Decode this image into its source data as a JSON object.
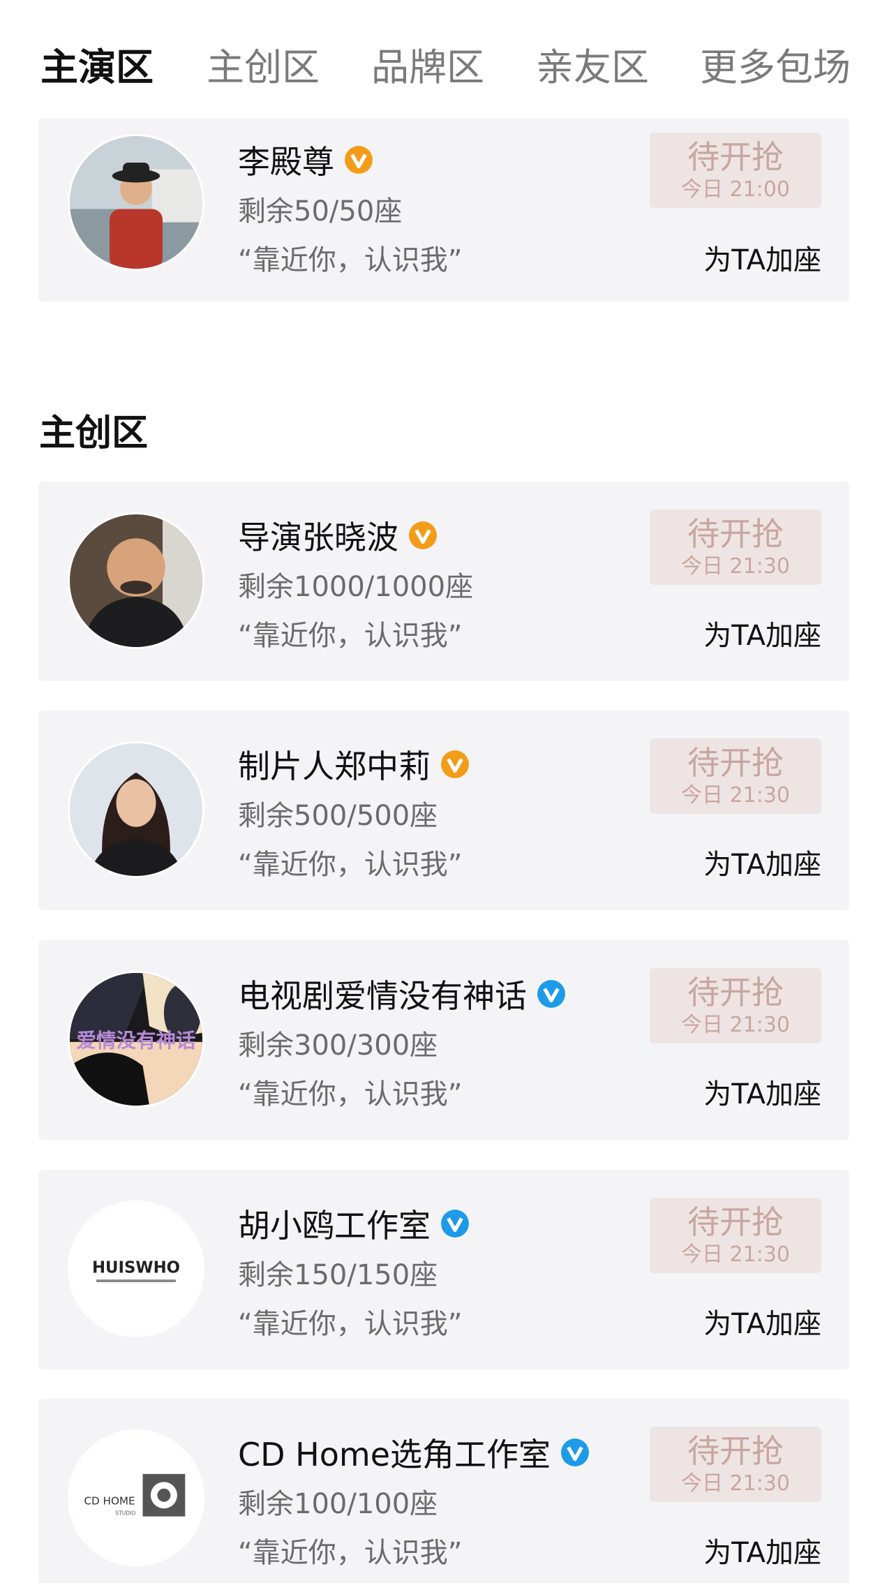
{
  "tabs": [
    "主演区",
    "主创区",
    "品牌区",
    "亲友区",
    "更多包场"
  ],
  "active_tab_index": 0,
  "section_main_creators_title": "主创区",
  "common": {
    "slogan": "“靠近你，认识我”",
    "grab_label": "待开抢",
    "add_seat_label": "为TA加座"
  },
  "colors": {
    "badge_orange": "#f39c1a",
    "badge_blue": "#1e9be8",
    "grab_bg": "#eee4e4",
    "grab_text": "#c8a69f",
    "card_bg": "#f4f4f6"
  },
  "cards": [
    {
      "name": "李殿尊",
      "badge": "orange",
      "seats": "剩余50/50座",
      "time": "今日 21:00",
      "avatar": "person-red-shirt-hat"
    },
    {
      "name": "导演张晓波",
      "badge": "orange",
      "seats": "剩余1000/1000座",
      "time": "今日 21:30",
      "avatar": "bald-man"
    },
    {
      "name": "制片人郑中莉",
      "badge": "orange",
      "seats": "剩余500/500座",
      "time": "今日 21:30",
      "avatar": "woman-dark-hair"
    },
    {
      "name": "电视剧爱情没有神话",
      "badge": "blue",
      "seats": "剩余300/300座",
      "time": "今日 21:30",
      "avatar": "drama-poster",
      "avatar_text": "爱情没有神话"
    },
    {
      "name": "胡小鸥工作室",
      "badge": "blue",
      "seats": "剩余150/150座",
      "time": "今日 21:30",
      "avatar": "huiswho-logo",
      "avatar_text": "HUISWHO"
    },
    {
      "name": "CD Home选角工作室",
      "badge": "blue",
      "seats": "剩余100/100座",
      "time": "今日 21:30",
      "avatar": "cdhome-logo",
      "avatar_text": "CD HOME",
      "avatar_subtext": "STUDIO"
    }
  ]
}
